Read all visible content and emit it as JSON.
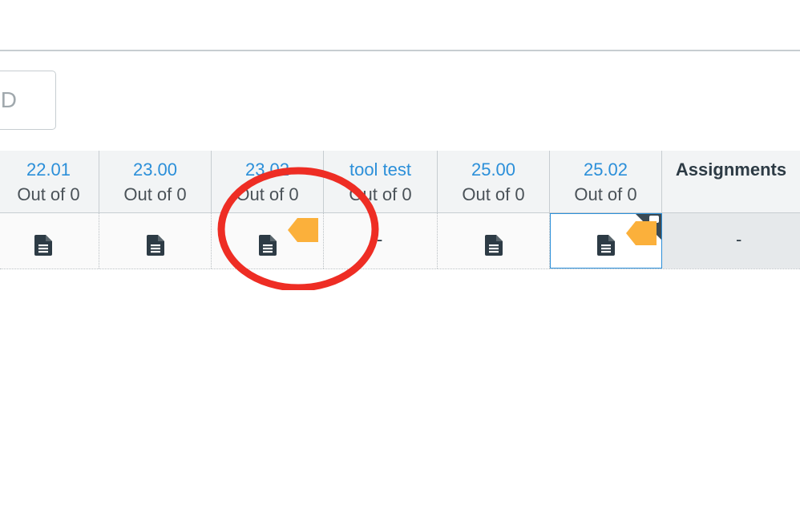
{
  "search": {
    "placeholder_fragment": "ID"
  },
  "columns": [
    {
      "name": "22.01",
      "points": "Out of 0"
    },
    {
      "name": "23.00",
      "points": "Out of 0"
    },
    {
      "name": "23.02",
      "points": "Out of 0"
    },
    {
      "name": "tool test",
      "points": "Out of 0"
    },
    {
      "name": "25.00",
      "points": "Out of 0"
    },
    {
      "name": "25.02",
      "points": "Out of 0"
    }
  ],
  "total_column": {
    "name": "Assignments"
  },
  "row": {
    "cells": [
      {
        "type": "document-icon"
      },
      {
        "type": "document-icon"
      },
      {
        "type": "document-icon",
        "status": "late"
      },
      {
        "type": "dash",
        "value": "-"
      },
      {
        "type": "document-icon"
      },
      {
        "type": "document-icon",
        "status": "late",
        "comment": true
      }
    ],
    "total_value": "-"
  },
  "colors": {
    "link_blue": "#2b8fd9",
    "late_flag": "#fbb03b",
    "annotation_red": "#ee2d24",
    "icon_dark": "#2d3b45"
  }
}
